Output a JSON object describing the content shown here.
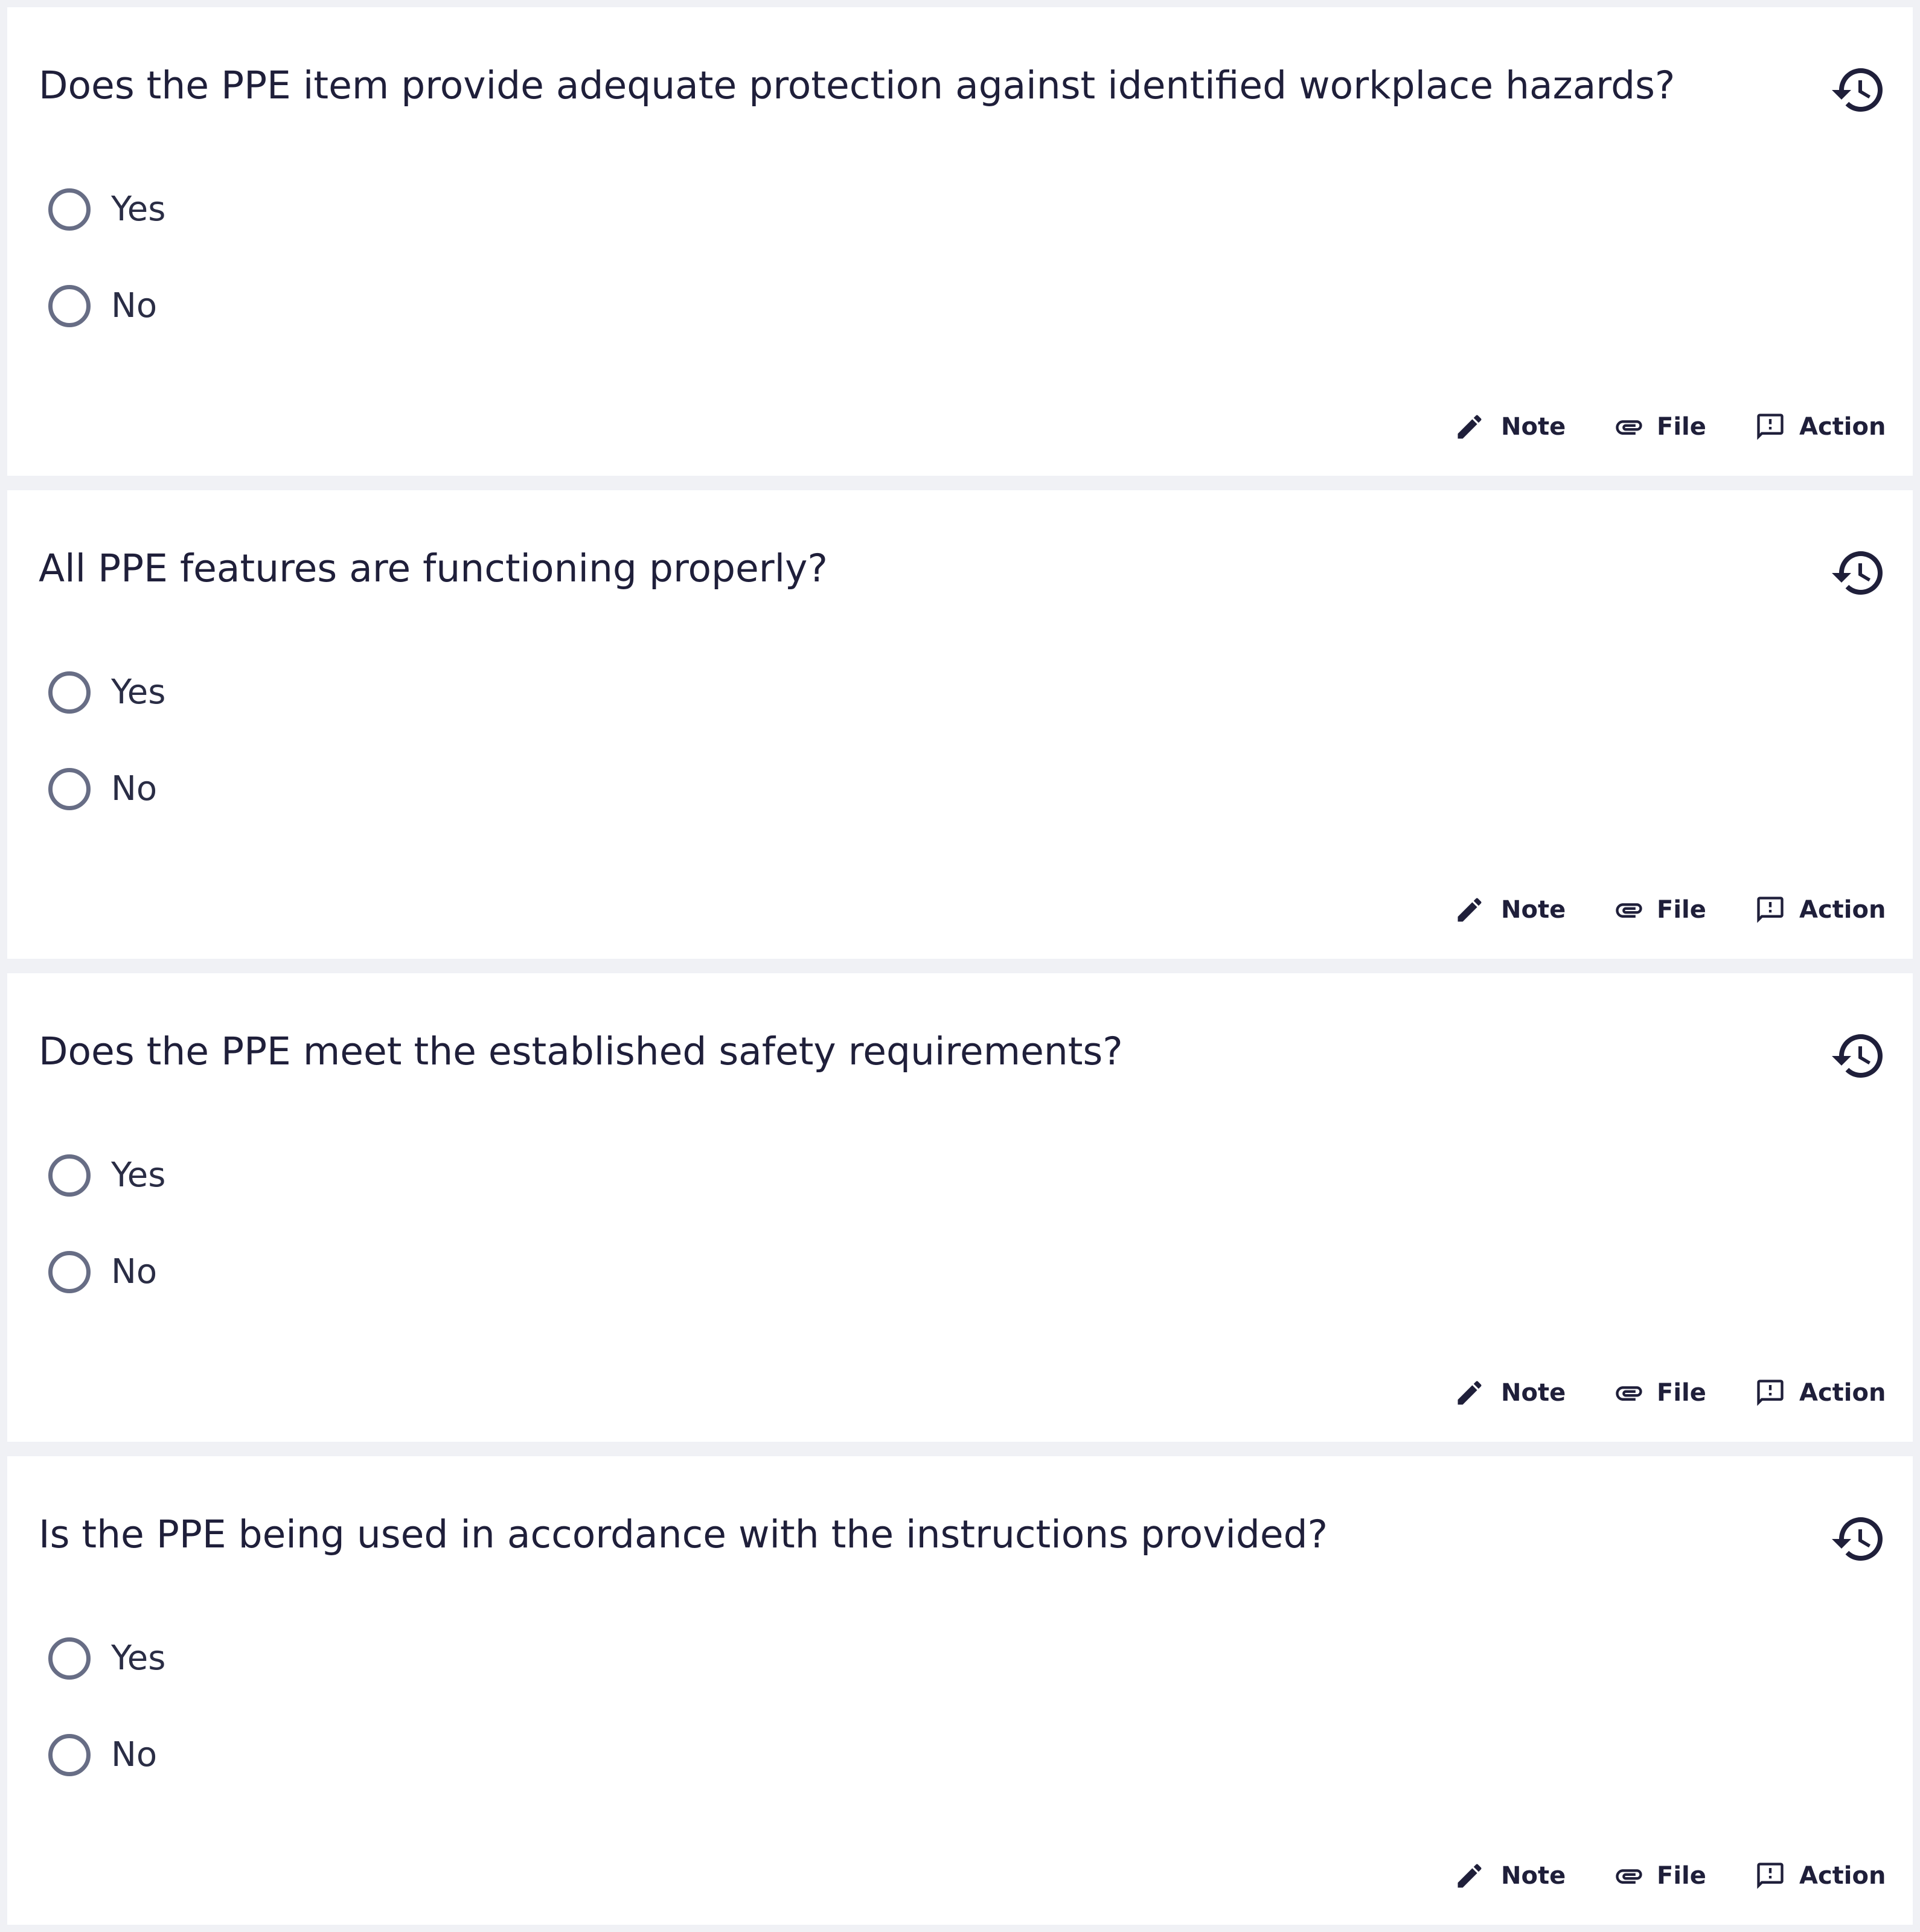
{
  "questions": [
    {
      "text": "Does the PPE item provide adequate protection against identified workplace hazards?",
      "options": [
        "Yes",
        "No"
      ]
    },
    {
      "text": "All PPE features are functioning properly?",
      "options": [
        "Yes",
        "No"
      ]
    },
    {
      "text": "Does the PPE meet the established safety requirements?",
      "options": [
        "Yes",
        "No"
      ]
    },
    {
      "text": "Is the PPE being used in accordance with the instructions provided?",
      "options": [
        "Yes",
        "No"
      ]
    }
  ],
  "actions": {
    "note_label": "Note",
    "file_label": "File",
    "action_label": "Action"
  },
  "icons": {
    "history": "history-icon",
    "note": "pencil-icon",
    "file": "paperclip-icon",
    "action": "feedback-icon"
  },
  "colors": {
    "background": "#f0f1f5",
    "card": "#ffffff",
    "text": "#1f1f3a",
    "radio_border": "#676d85"
  }
}
